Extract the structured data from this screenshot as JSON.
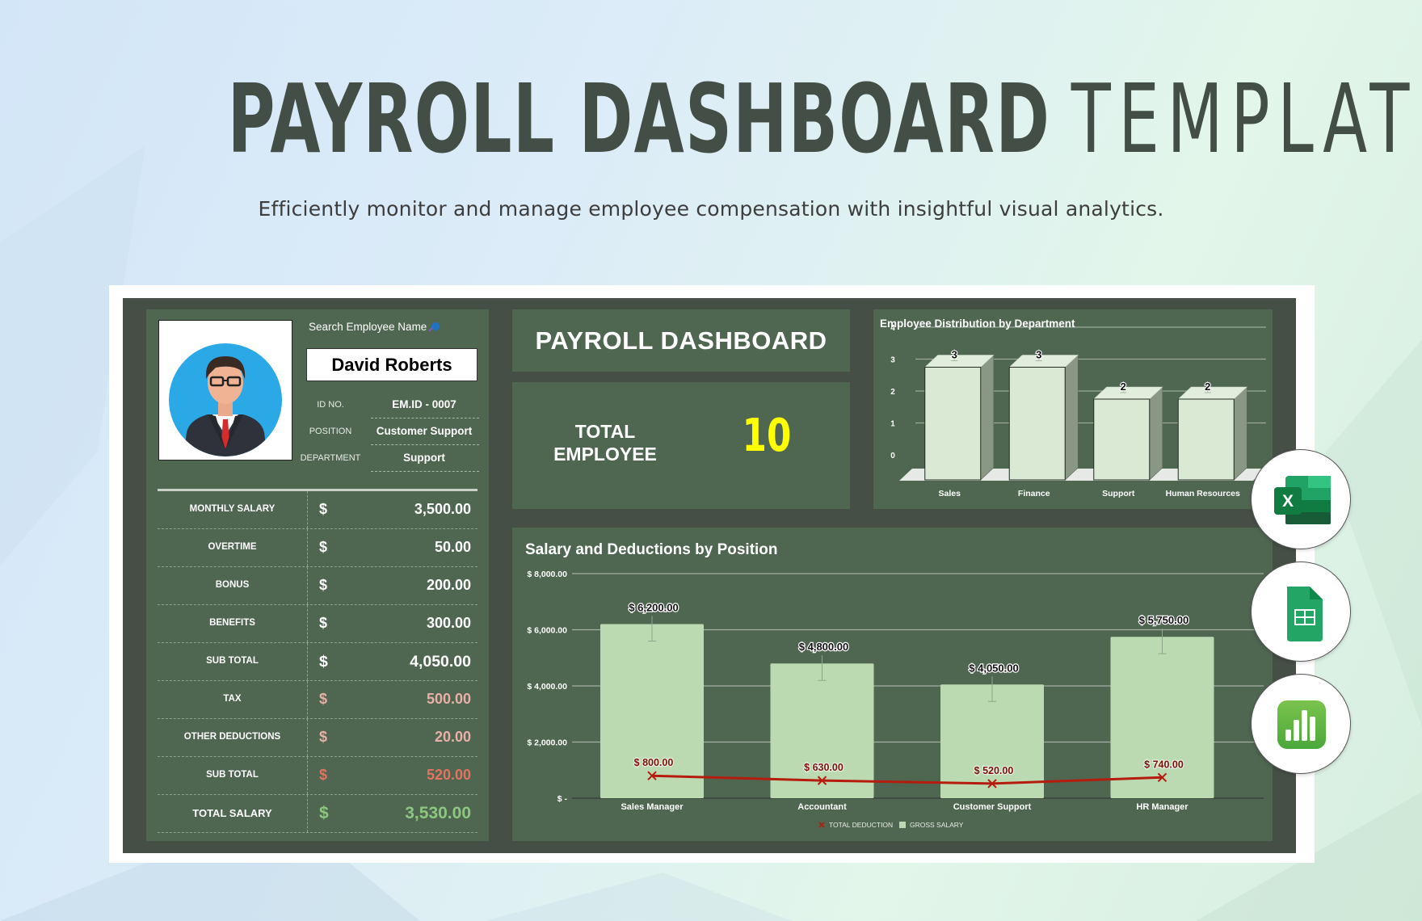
{
  "header": {
    "title_bold": "PAYROLL DASHBOARD",
    "title_light": "TEMPLATE",
    "subtitle": "Efficiently monitor and manage employee compensation with insightful visual analytics."
  },
  "employee": {
    "search_label": "Search Employee Name",
    "name": "David Roberts",
    "fields": [
      {
        "label": "ID NO.",
        "value": "EM.ID - 0007"
      },
      {
        "label": "POSITION",
        "value": "Customer Support"
      },
      {
        "label": "DEPARTMENT",
        "value": "Support"
      }
    ]
  },
  "pay_table": {
    "currency": "$",
    "rows": [
      {
        "label": "MONTHLY SALARY",
        "amount": "3,500.00",
        "kind": "earning"
      },
      {
        "label": "OVERTIME",
        "amount": "50.00",
        "kind": "earning"
      },
      {
        "label": "BONUS",
        "amount": "200.00",
        "kind": "earning"
      },
      {
        "label": "BENEFITS",
        "amount": "300.00",
        "kind": "earning"
      },
      {
        "label": "SUB TOTAL",
        "amount": "4,050.00",
        "kind": "earning-subtotal"
      },
      {
        "label": "TAX",
        "amount": "500.00",
        "kind": "deduction"
      },
      {
        "label": "OTHER DEDUCTIONS",
        "amount": "20.00",
        "kind": "deduction"
      },
      {
        "label": "SUB TOTAL",
        "amount": "520.00",
        "kind": "deduction-subtotal"
      },
      {
        "label": "TOTAL SALARY",
        "amount": "3,530.00",
        "kind": "total"
      }
    ]
  },
  "dashboard": {
    "title": "PAYROLL DASHBOARD",
    "total_employee_label_1": "TOTAL",
    "total_employee_label_2": "EMPLOYEE",
    "total_employee_value": "10"
  },
  "colors": {
    "panel": "#4f6651",
    "frame": "#454f46",
    "earning_text": "#ffffff",
    "deduction_text": "#e8b0a6",
    "deduction_subtotal_text": "#e2735f",
    "total_text": "#8dc77f",
    "accent_yellow": "#ffff00",
    "bar_light": "#bcdab2",
    "bar_dept": "#d9e9d3",
    "deduction_line": "#b51c0d"
  },
  "app_icons": [
    {
      "name": "excel-icon",
      "letter": "X"
    },
    {
      "name": "google-sheets-icon"
    },
    {
      "name": "numbers-icon"
    }
  ],
  "chart_data": [
    {
      "type": "bar",
      "title": "Employee Distribution by Department",
      "categories": [
        "Sales",
        "Finance",
        "Support",
        "Human Resources"
      ],
      "values": [
        3,
        3,
        2,
        2
      ],
      "data_labels": [
        "3",
        "3",
        "2",
        "2"
      ],
      "yticks": [
        "0",
        "1",
        "2",
        "3",
        "4"
      ],
      "ylim": [
        0,
        4
      ],
      "xlabel": "",
      "ylabel": "",
      "grid": true,
      "style": "3d-column"
    },
    {
      "type": "bar",
      "title": "Salary and Deductions by Position",
      "categories": [
        "Sales Manager",
        "Accountant",
        "Customer Support",
        "HR Manager"
      ],
      "series": [
        {
          "name": "GROSS SALARY",
          "type": "bar",
          "values": [
            6200,
            4800,
            4050,
            5750
          ],
          "data_labels": [
            "$ 6,200.00",
            "$ 4,800.00",
            "$ 4,050.00",
            "$ 5,750.00"
          ]
        },
        {
          "name": "TOTAL DEDUCTION",
          "type": "line",
          "values": [
            800,
            630,
            520,
            740
          ],
          "data_labels": [
            "$ 800.00",
            "$ 630.00",
            "$ 520.00",
            "$ 740.00"
          ]
        }
      ],
      "yticks": [
        "$ -",
        "$ 2,000.00",
        "$ 4,000.00",
        "$ 6,000.00",
        "$ 8,000.00"
      ],
      "ylim": [
        0,
        8000
      ],
      "xlabel": "",
      "ylabel": "",
      "grid": true,
      "legend": {
        "position": "bottom",
        "entries": [
          "TOTAL DEDUCTION",
          "GROSS SALARY"
        ]
      }
    }
  ]
}
